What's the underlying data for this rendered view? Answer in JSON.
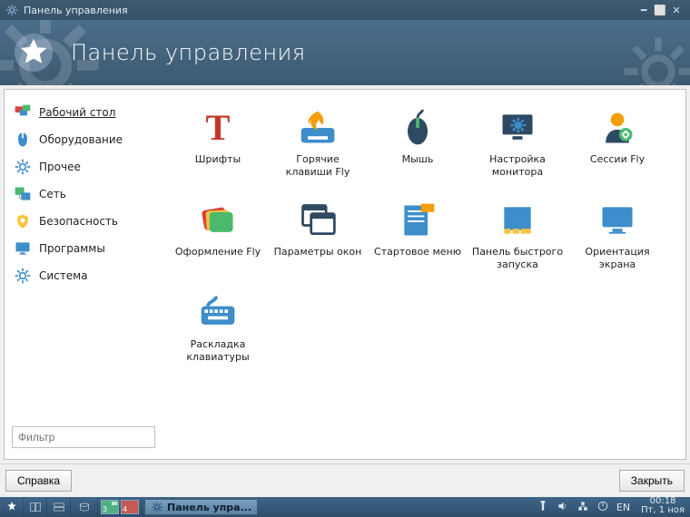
{
  "colors": {
    "accent_blue": "#3d8ecb",
    "accent_orange": "#f59e0b",
    "accent_red": "#d9443a",
    "banner": "#3d5a70"
  },
  "titlebar": {
    "title": "Панель управления"
  },
  "banner": {
    "heading": "Панель управления"
  },
  "sidebar": {
    "items": [
      {
        "key": "desktop",
        "label": "Рабочий стол",
        "selected": true
      },
      {
        "key": "hardware",
        "label": "Оборудование",
        "selected": false
      },
      {
        "key": "other",
        "label": "Прочее",
        "selected": false
      },
      {
        "key": "network",
        "label": "Сеть",
        "selected": false
      },
      {
        "key": "security",
        "label": "Безопасность",
        "selected": false
      },
      {
        "key": "programs",
        "label": "Программы",
        "selected": false
      },
      {
        "key": "system",
        "label": "Система",
        "selected": false
      }
    ],
    "filter_placeholder": "Фильтр"
  },
  "tiles": [
    {
      "key": "fonts",
      "label": "Шрифты"
    },
    {
      "key": "hotkeys",
      "label": "Горячие клавиши Fly"
    },
    {
      "key": "mouse",
      "label": "Мышь"
    },
    {
      "key": "monitor",
      "label": "Настройка монитора"
    },
    {
      "key": "sessions",
      "label": "Сессии Fly"
    },
    {
      "key": "theme",
      "label": "Оформление Fly"
    },
    {
      "key": "winparams",
      "label": "Параметры окон"
    },
    {
      "key": "startmenu",
      "label": "Стартовое меню"
    },
    {
      "key": "quickpanel",
      "label": "Панель быстрого запуска"
    },
    {
      "key": "orientation",
      "label": "Ориентация экрана"
    },
    {
      "key": "kblayout",
      "label": "Раскладка клавиатуры"
    }
  ],
  "buttons": {
    "help": "Справка",
    "close": "Закрыть"
  },
  "taskbar": {
    "desktops": [
      "3",
      "4"
    ],
    "active_task": "Панель упра...",
    "lang": "EN",
    "clock_time": "00:18",
    "clock_date": "Пт, 1 ноя"
  }
}
